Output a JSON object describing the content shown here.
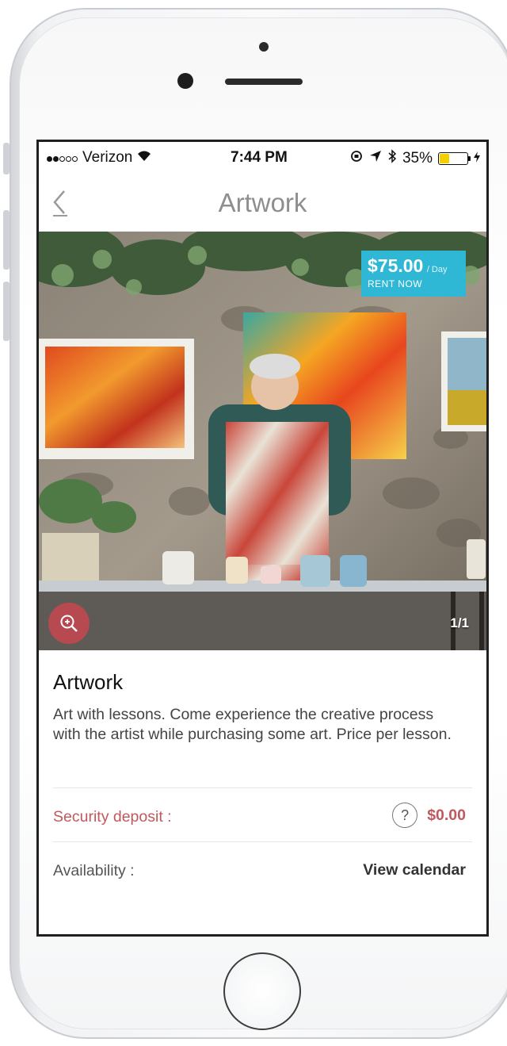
{
  "status_bar": {
    "carrier": "Verizon",
    "time": "7:44 PM",
    "battery": "35%",
    "battery_level": 0.35,
    "signal_bars_full": 2,
    "signal_bars_total": 5
  },
  "nav": {
    "title": "Artwork",
    "back_icon": "chevron-left-icon"
  },
  "hero": {
    "price": "$75.00",
    "price_unit": "/ Day",
    "cta": "RENT NOW",
    "image_counter": "1/1",
    "zoom_icon": "zoom-in-icon"
  },
  "item": {
    "title": "Artwork",
    "description": "Art with lessons. Come experience the creative process with the artist while purchasing some art. Price per lesson."
  },
  "security_deposit": {
    "label": "Security deposit :",
    "help_icon": "?",
    "value": "$0.00"
  },
  "availability": {
    "label": "Availability :",
    "action": "View calendar"
  },
  "colors": {
    "accent": "#2eb8d6",
    "danger": "#c0595d",
    "zoom_button": "#b64a50"
  }
}
